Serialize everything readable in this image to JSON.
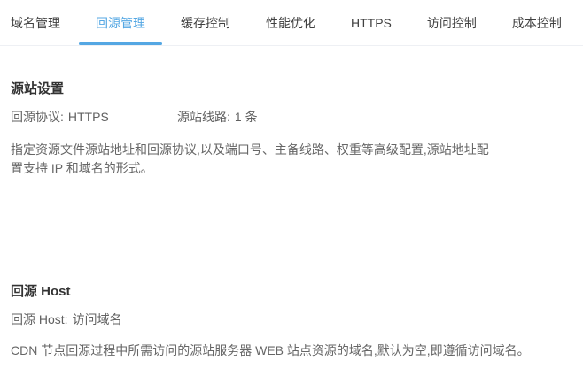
{
  "colors": {
    "accent": "#54a7e3",
    "tab_text": "#404040",
    "title_text": "#333333",
    "body_text": "#666666",
    "divider": "#f1f2f5"
  },
  "tabs": {
    "items": [
      {
        "label": "域名管理",
        "active": false
      },
      {
        "label": "回源管理",
        "active": true
      },
      {
        "label": "缓存控制",
        "active": false
      },
      {
        "label": "性能优化",
        "active": false
      },
      {
        "label": "HTTPS",
        "active": false
      },
      {
        "label": "访问控制",
        "active": false
      },
      {
        "label": "成本控制",
        "active": false
      }
    ]
  },
  "sections": [
    {
      "title": "源站设置",
      "fields": [
        {
          "label": "回源协议:",
          "value": "HTTPS"
        },
        {
          "label": "源站线路:",
          "value": "1 条"
        }
      ],
      "description": "指定资源文件源站地址和回源协议,以及端口号、主备线路、权重等高级配置,源站地址配置支持 IP 和域名的形式。"
    },
    {
      "title": "回源 Host",
      "fields": [
        {
          "label": "回源 Host:",
          "value": "访问域名"
        }
      ],
      "description": "CDN 节点回源过程中所需访问的源站服务器 WEB 站点资源的域名,默认为空,即遵循访问域名。"
    }
  ]
}
